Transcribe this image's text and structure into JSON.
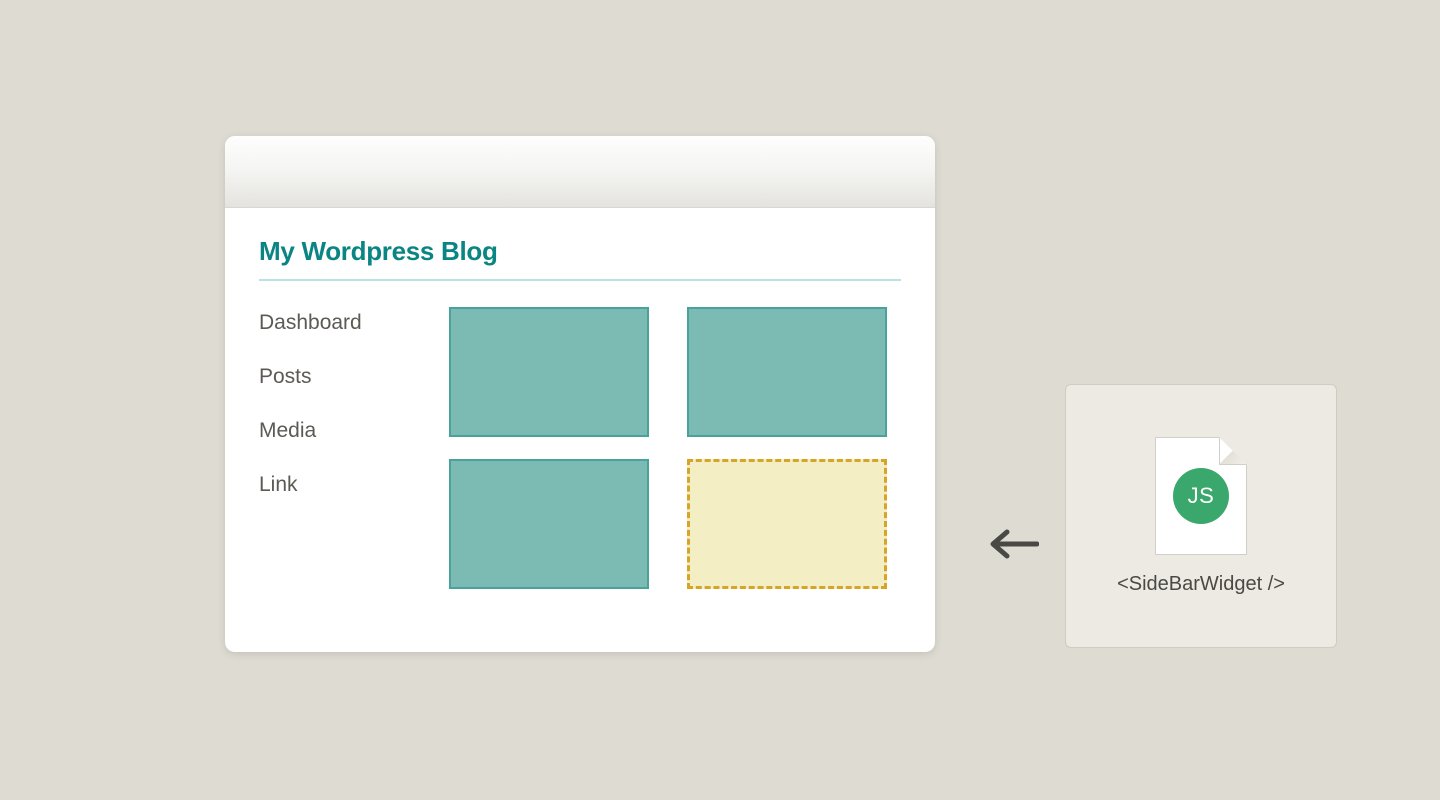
{
  "window": {
    "title": "My Wordpress Blog"
  },
  "sidebar": {
    "items": [
      {
        "label": "Dashboard"
      },
      {
        "label": "Posts"
      },
      {
        "label": "Media"
      },
      {
        "label": "Link"
      }
    ]
  },
  "component": {
    "badge": "JS",
    "label": "<SideBarWidget />"
  }
}
